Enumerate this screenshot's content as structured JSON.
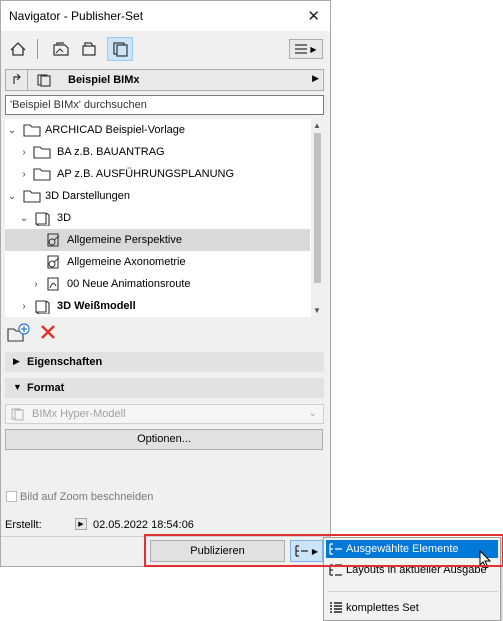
{
  "window": {
    "title": "Navigator - Publisher-Set",
    "close_glyph": "✕"
  },
  "toolbar": {
    "icons": [
      "home-icon",
      "layout-book-icon",
      "view-map-icon",
      "publisher-set-icon"
    ],
    "menu_icon": "hamburger-menu-icon"
  },
  "set_bar": {
    "name": "Beispiel BIMx",
    "arrow": "▶"
  },
  "search": {
    "placeholder": "'Beispiel BIMx' durchsuchen"
  },
  "tree": {
    "items": [
      {
        "label": "ARCHICAD Beispiel-Vorlage",
        "expander": "⌄",
        "icon": "folder-icon",
        "selected": false
      },
      {
        "label": "BA z.B. BAUANTRAG",
        "expander": "›",
        "icon": "folder-icon",
        "selected": false
      },
      {
        "label": "AP z.B. AUSFÜHRUNGSPLANUNG",
        "expander": "›",
        "icon": "folder-icon",
        "selected": false
      },
      {
        "label": "3D Darstellungen",
        "expander": "⌄",
        "icon": "folder-icon",
        "selected": false
      },
      {
        "label": "3D",
        "expander": "⌄",
        "icon": "3d-view-icon",
        "selected": false
      },
      {
        "label": "Allgemeine Perspektive",
        "expander": "",
        "icon": "perspective-icon",
        "selected": true
      },
      {
        "label": "Allgemeine Axonometrie",
        "expander": "",
        "icon": "axonometry-icon",
        "selected": false
      },
      {
        "label": "00 Neue Animationsroute",
        "expander": "›",
        "icon": "animation-icon",
        "selected": false
      },
      {
        "label": "3D Weißmodell",
        "expander": "›",
        "icon": "3d-view-icon",
        "selected": false
      }
    ]
  },
  "actions": {
    "add_icon": "add-folder-icon",
    "delete_icon": "delete-icon"
  },
  "panels": {
    "properties": {
      "label": "Eigenschaften",
      "state": "collapsed"
    },
    "format": {
      "label": "Format",
      "state": "expanded"
    }
  },
  "format": {
    "selected": "BIMx Hyper-Modell",
    "options_button": "Optionen..."
  },
  "crop": {
    "label": "Bild auf Zoom beschneiden",
    "checked": false
  },
  "created": {
    "label": "Erstellt:",
    "value": "02.05.2022 18:54:06"
  },
  "publish": {
    "label": "Publizieren"
  },
  "publish_menu": {
    "items": [
      {
        "label": "Ausgewählte Elemente",
        "highlighted": true
      },
      {
        "label": "Layouts in aktueller Ausgabe",
        "highlighted": false
      },
      {
        "label": "komplettes Set",
        "highlighted": false
      }
    ]
  },
  "colors": {
    "highlight": "#0078d7",
    "selection": "#d9d9d9",
    "callout": "#e03030",
    "delete": "#e0302a"
  }
}
